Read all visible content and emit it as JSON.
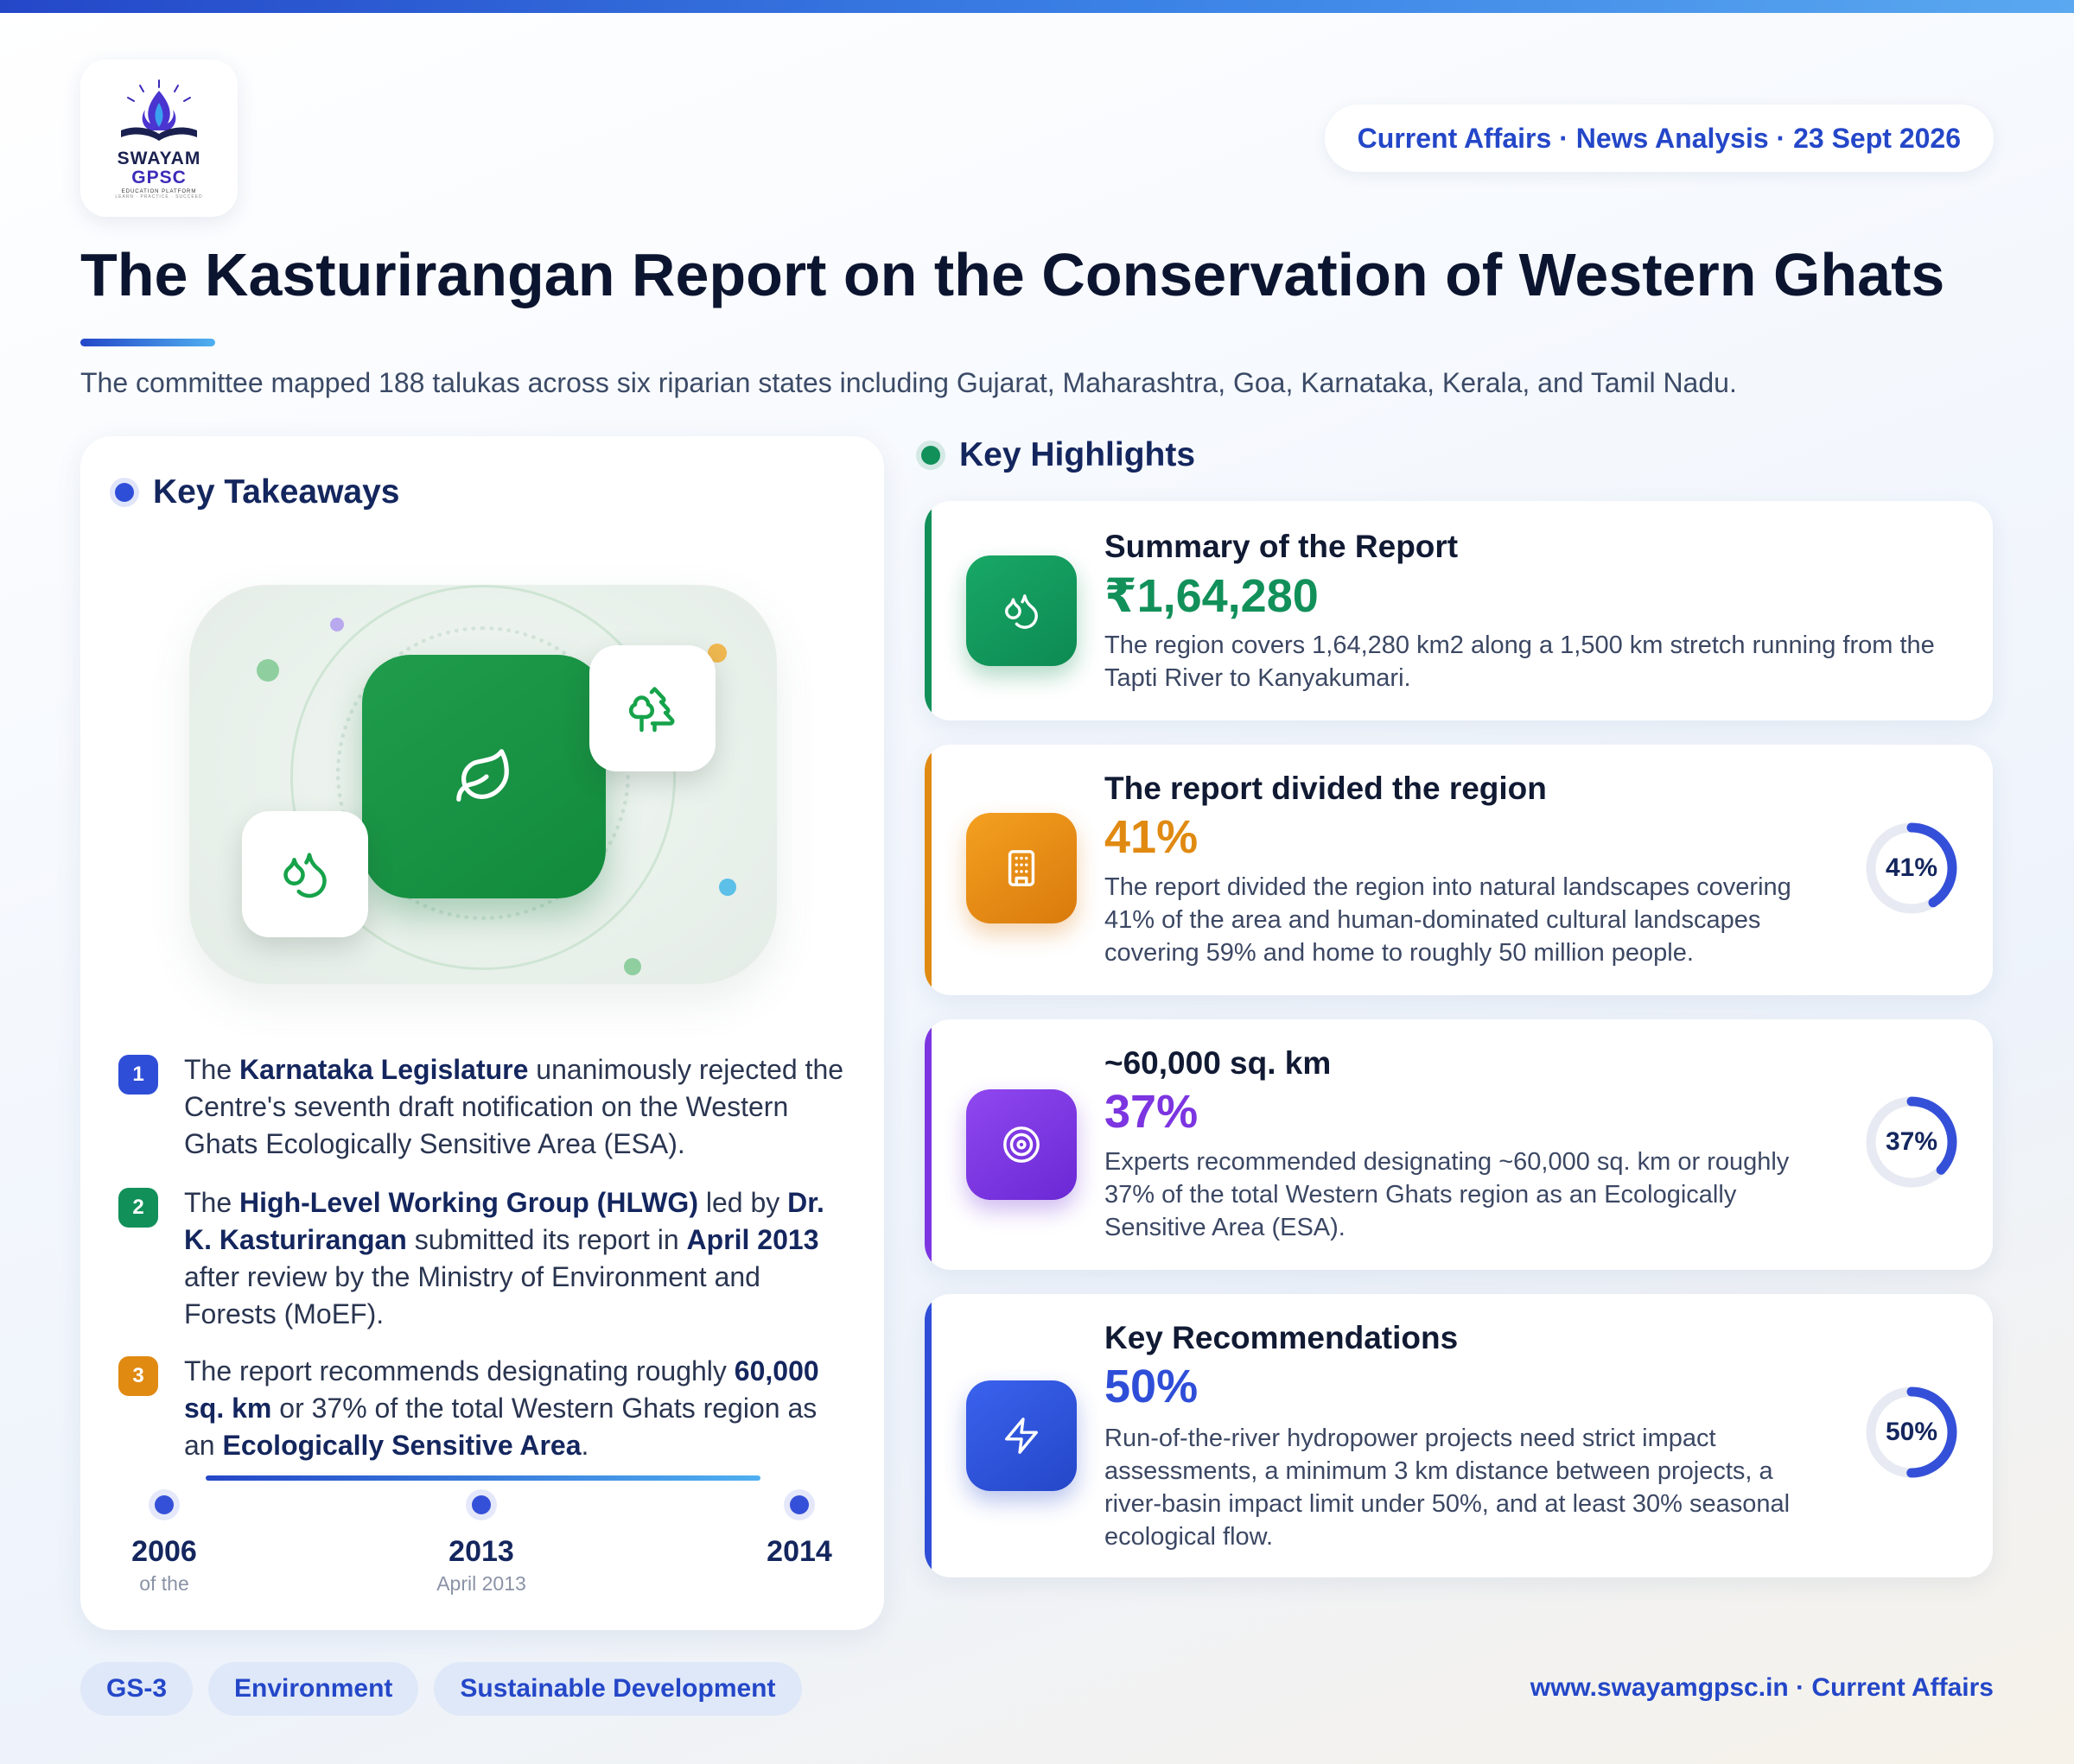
{
  "brand": {
    "line1": "SWAYAM",
    "line2": "GPSC",
    "line3": "EDUCATION PLATFORM",
    "line4": "LEARN · PRACTICE · SUCCEED"
  },
  "header": {
    "pill": "Current Affairs · News Analysis · 23 Sept 2026",
    "title": "The Kasturirangan Report on the Conservation of Western Ghats",
    "subtitle": "The committee mapped 188 talukas across six riparian states including Gujarat, Maharashtra, Goa, Karnataka, Kerala, and Tamil Nadu."
  },
  "takeaways": {
    "title": "Key Takeaways",
    "illustration_icons": [
      "leaf-icon",
      "trees-icon",
      "droplets-icon"
    ],
    "items": [
      {
        "num": "1",
        "color": "#2f4ed8",
        "parts": [
          {
            "t": "The "
          },
          {
            "t": "Karnataka Legislature",
            "b": true
          },
          {
            "t": " unanimously rejected the Centre's seventh draft notification on the Western Ghats Ecologically Sensitive Area (ESA)."
          }
        ]
      },
      {
        "num": "2",
        "color": "#12905a",
        "parts": [
          {
            "t": "The "
          },
          {
            "t": "High-Level Working Group (HLWG)",
            "b": true
          },
          {
            "t": " led by "
          },
          {
            "t": "Dr. K. Kasturirangan",
            "b": true
          },
          {
            "t": " submitted its report in "
          },
          {
            "t": "April 2013",
            "b": true
          },
          {
            "t": " after review by the Ministry of Environment and Forests (MoEF)."
          }
        ]
      },
      {
        "num": "3",
        "color": "#e08a12",
        "parts": [
          {
            "t": "The report recommends designating roughly "
          },
          {
            "t": "60,000 sq. km",
            "b": true
          },
          {
            "t": " or 37% of the total Western Ghats region as an "
          },
          {
            "t": "Ecologically Sensitive Area",
            "b": true
          },
          {
            "t": "."
          }
        ]
      }
    ],
    "timeline": [
      {
        "year": "2006",
        "sub": "of the"
      },
      {
        "year": "2013",
        "sub": "April 2013"
      },
      {
        "year": "2014",
        "sub": ""
      }
    ]
  },
  "highlights": {
    "title": "Key Highlights",
    "cards": [
      {
        "heading": "Summary of the Report",
        "value": "₹1,64,280",
        "desc": "The region covers 1,64,280 km2 along a 1,500 km stretch running from the Tapti River to Kanyakumari.",
        "icon": "droplets-icon",
        "color": "#12905a"
      },
      {
        "heading": "The report divided the region",
        "value": "41%",
        "percent": 41,
        "desc": "The report divided the region into natural landscapes covering 41% of the area and human-dominated cultural landscapes covering 59% and home to roughly 50 million people.",
        "icon": "building-icon",
        "color": "#e08a12"
      },
      {
        "heading": "~60,000 sq. km",
        "value": "37%",
        "percent": 37,
        "desc": "Experts recommended designating ~60,000 sq. km or roughly 37% of the total Western Ghats region as an Ecologically Sensitive Area (ESA).",
        "icon": "target-icon",
        "color": "#7c35e0"
      },
      {
        "heading": "Key Recommendations",
        "value": "50%",
        "percent": 50,
        "desc": "Run-of-the-river hydropower projects need strict impact assessments, a minimum 3 km distance between projects, a river-basin impact limit under 50%, and at least 30% seasonal ecological flow.",
        "icon": "bolt-icon",
        "color": "#2f4ed8"
      }
    ]
  },
  "footer": {
    "tags": [
      "GS-3",
      "Environment",
      "Sustainable Development"
    ],
    "right": "www.swayamgpsc.in · Current Affairs"
  }
}
